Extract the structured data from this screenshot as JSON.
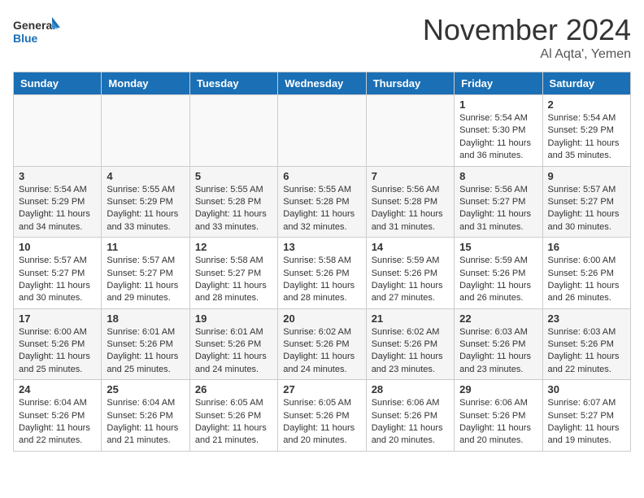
{
  "header": {
    "logo": {
      "general": "General",
      "blue": "Blue"
    },
    "month": "November 2024",
    "location": "Al Aqta', Yemen"
  },
  "weekdays": [
    "Sunday",
    "Monday",
    "Tuesday",
    "Wednesday",
    "Thursday",
    "Friday",
    "Saturday"
  ],
  "weeks": [
    [
      {
        "day": "",
        "info": ""
      },
      {
        "day": "",
        "info": ""
      },
      {
        "day": "",
        "info": ""
      },
      {
        "day": "",
        "info": ""
      },
      {
        "day": "",
        "info": ""
      },
      {
        "day": "1",
        "info": "Sunrise: 5:54 AM\nSunset: 5:30 PM\nDaylight: 11 hours and 36 minutes."
      },
      {
        "day": "2",
        "info": "Sunrise: 5:54 AM\nSunset: 5:29 PM\nDaylight: 11 hours and 35 minutes."
      }
    ],
    [
      {
        "day": "3",
        "info": "Sunrise: 5:54 AM\nSunset: 5:29 PM\nDaylight: 11 hours and 34 minutes."
      },
      {
        "day": "4",
        "info": "Sunrise: 5:55 AM\nSunset: 5:29 PM\nDaylight: 11 hours and 33 minutes."
      },
      {
        "day": "5",
        "info": "Sunrise: 5:55 AM\nSunset: 5:28 PM\nDaylight: 11 hours and 33 minutes."
      },
      {
        "day": "6",
        "info": "Sunrise: 5:55 AM\nSunset: 5:28 PM\nDaylight: 11 hours and 32 minutes."
      },
      {
        "day": "7",
        "info": "Sunrise: 5:56 AM\nSunset: 5:28 PM\nDaylight: 11 hours and 31 minutes."
      },
      {
        "day": "8",
        "info": "Sunrise: 5:56 AM\nSunset: 5:27 PM\nDaylight: 11 hours and 31 minutes."
      },
      {
        "day": "9",
        "info": "Sunrise: 5:57 AM\nSunset: 5:27 PM\nDaylight: 11 hours and 30 minutes."
      }
    ],
    [
      {
        "day": "10",
        "info": "Sunrise: 5:57 AM\nSunset: 5:27 PM\nDaylight: 11 hours and 30 minutes."
      },
      {
        "day": "11",
        "info": "Sunrise: 5:57 AM\nSunset: 5:27 PM\nDaylight: 11 hours and 29 minutes."
      },
      {
        "day": "12",
        "info": "Sunrise: 5:58 AM\nSunset: 5:27 PM\nDaylight: 11 hours and 28 minutes."
      },
      {
        "day": "13",
        "info": "Sunrise: 5:58 AM\nSunset: 5:26 PM\nDaylight: 11 hours and 28 minutes."
      },
      {
        "day": "14",
        "info": "Sunrise: 5:59 AM\nSunset: 5:26 PM\nDaylight: 11 hours and 27 minutes."
      },
      {
        "day": "15",
        "info": "Sunrise: 5:59 AM\nSunset: 5:26 PM\nDaylight: 11 hours and 26 minutes."
      },
      {
        "day": "16",
        "info": "Sunrise: 6:00 AM\nSunset: 5:26 PM\nDaylight: 11 hours and 26 minutes."
      }
    ],
    [
      {
        "day": "17",
        "info": "Sunrise: 6:00 AM\nSunset: 5:26 PM\nDaylight: 11 hours and 25 minutes."
      },
      {
        "day": "18",
        "info": "Sunrise: 6:01 AM\nSunset: 5:26 PM\nDaylight: 11 hours and 25 minutes."
      },
      {
        "day": "19",
        "info": "Sunrise: 6:01 AM\nSunset: 5:26 PM\nDaylight: 11 hours and 24 minutes."
      },
      {
        "day": "20",
        "info": "Sunrise: 6:02 AM\nSunset: 5:26 PM\nDaylight: 11 hours and 24 minutes."
      },
      {
        "day": "21",
        "info": "Sunrise: 6:02 AM\nSunset: 5:26 PM\nDaylight: 11 hours and 23 minutes."
      },
      {
        "day": "22",
        "info": "Sunrise: 6:03 AM\nSunset: 5:26 PM\nDaylight: 11 hours and 23 minutes."
      },
      {
        "day": "23",
        "info": "Sunrise: 6:03 AM\nSunset: 5:26 PM\nDaylight: 11 hours and 22 minutes."
      }
    ],
    [
      {
        "day": "24",
        "info": "Sunrise: 6:04 AM\nSunset: 5:26 PM\nDaylight: 11 hours and 22 minutes."
      },
      {
        "day": "25",
        "info": "Sunrise: 6:04 AM\nSunset: 5:26 PM\nDaylight: 11 hours and 21 minutes."
      },
      {
        "day": "26",
        "info": "Sunrise: 6:05 AM\nSunset: 5:26 PM\nDaylight: 11 hours and 21 minutes."
      },
      {
        "day": "27",
        "info": "Sunrise: 6:05 AM\nSunset: 5:26 PM\nDaylight: 11 hours and 20 minutes."
      },
      {
        "day": "28",
        "info": "Sunrise: 6:06 AM\nSunset: 5:26 PM\nDaylight: 11 hours and 20 minutes."
      },
      {
        "day": "29",
        "info": "Sunrise: 6:06 AM\nSunset: 5:26 PM\nDaylight: 11 hours and 20 minutes."
      },
      {
        "day": "30",
        "info": "Sunrise: 6:07 AM\nSunset: 5:27 PM\nDaylight: 11 hours and 19 minutes."
      }
    ]
  ]
}
